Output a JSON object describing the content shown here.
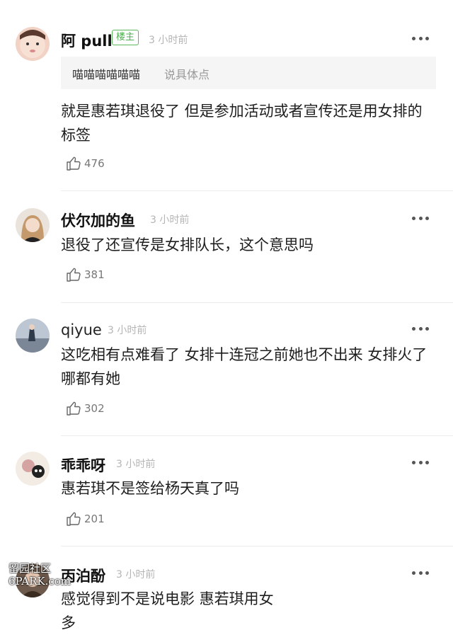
{
  "comments": [
    {
      "user": "阿 pull",
      "badge": "楼主",
      "time": "3 小时前",
      "quote": {
        "user": "喵喵喵喵喵喵",
        "text": "说具体点"
      },
      "text": "就是惠若琪退役了 但是参加活动或者宣传还是用女排的标签",
      "likes": "476"
    },
    {
      "user": "伏尔加的鱼",
      "time": "3 小时前",
      "text": "退役了还宣传是女排队长，这个意思吗",
      "likes": "381"
    },
    {
      "user": "qiyue",
      "time": "3 小时前",
      "text": "这吃相有点难看了 女排十连冠之前她也不出来 女排火了哪都有她",
      "likes": "302"
    },
    {
      "user": "乖乖呀",
      "time": "3 小时前",
      "text": "惠若琪不是签给杨天真了吗",
      "likes": "201"
    },
    {
      "user": "丙泊酚",
      "time": "3 小时前",
      "text": "感觉得到不是说电影 惠若琪用女",
      "text2": "多"
    }
  ],
  "watermark": {
    "line1": "留园社区",
    "line2": "6PARK.com"
  },
  "icons": {
    "more": "more-dots-icon",
    "like": "thumbs-up-icon"
  },
  "colors": {
    "badge": "#4caf50",
    "time": "#b5b5b5",
    "quote_bg": "#f5f5f5"
  }
}
